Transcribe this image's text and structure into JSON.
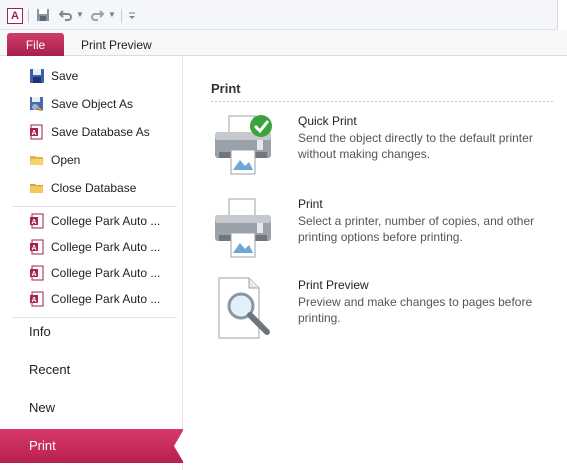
{
  "quick_access": {
    "app_icon_letter": "A",
    "save_icon": "save-icon",
    "undo_icon": "undo-icon",
    "redo_icon": "redo-icon",
    "customize_icon": "customize-qat-icon"
  },
  "ribbon": {
    "file_tab": "File",
    "print_preview_tab": "Print Preview"
  },
  "nav": {
    "commands": [
      {
        "label": "Save",
        "icon": "save-icon"
      },
      {
        "label": "Save Object As",
        "icon": "save-object-as-icon"
      },
      {
        "label": "Save Database As",
        "icon": "save-database-as-icon"
      },
      {
        "label": "Open",
        "icon": "open-folder-icon"
      },
      {
        "label": "Close Database",
        "icon": "close-database-icon"
      }
    ],
    "recent_files": [
      {
        "label": "College Park Auto ...",
        "icon": "access-database-icon"
      },
      {
        "label": "College Park Auto ...",
        "icon": "access-database-icon"
      },
      {
        "label": "College Park Auto ...",
        "icon": "access-database-icon"
      },
      {
        "label": "College Park Auto ...",
        "icon": "access-database-icon"
      }
    ],
    "categories": [
      {
        "label": "Info"
      },
      {
        "label": "Recent"
      },
      {
        "label": "New"
      },
      {
        "label": "Print",
        "active": true
      }
    ]
  },
  "main": {
    "section_title": "Print",
    "options": [
      {
        "title": "Quick Print",
        "description": "Send the object directly to the default printer without making changes.",
        "icon": "quick-print-icon"
      },
      {
        "title": "Print",
        "description": "Select a printer, number of copies, and other printing options before printing.",
        "icon": "printer-icon"
      },
      {
        "title": "Print Preview",
        "description": "Preview and make changes to pages before printing.",
        "icon": "print-preview-icon"
      }
    ]
  },
  "colors": {
    "accent": "#b7204f",
    "accent_light": "#d73a69"
  }
}
